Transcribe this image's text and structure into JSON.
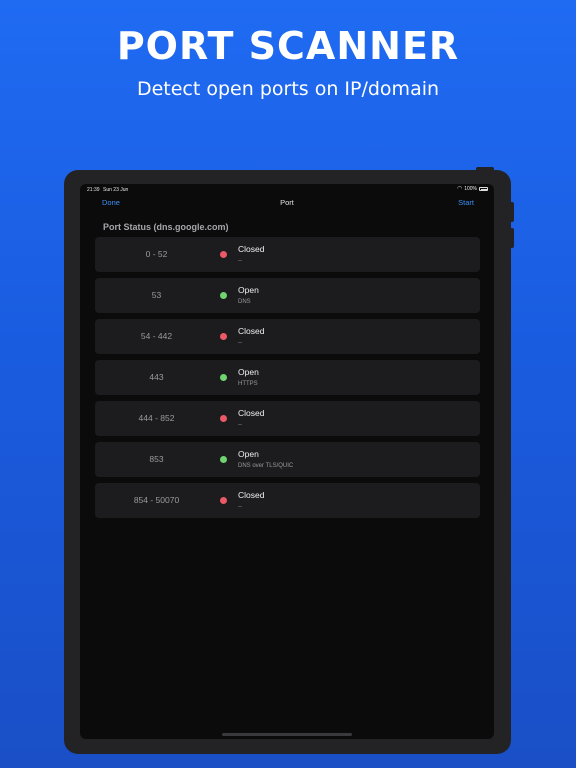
{
  "promo": {
    "title": "PORT SCANNER",
    "subtitle": "Detect open ports on IP/domain"
  },
  "status_bar": {
    "time": "21:39",
    "date": "Sun 23 Jun",
    "battery": "100%"
  },
  "nav": {
    "left_label": "Done",
    "title": "Port",
    "right_label": "Start"
  },
  "section": {
    "header": "Port Status (dns.google.com)"
  },
  "colors": {
    "closed": "#ea5965",
    "open": "#6fd36f",
    "accent": "#3a8ff5"
  },
  "ports": [
    {
      "range": "0 - 52",
      "status": "Closed",
      "detail": "--"
    },
    {
      "range": "53",
      "status": "Open",
      "detail": "DNS"
    },
    {
      "range": "54 - 442",
      "status": "Closed",
      "detail": "--"
    },
    {
      "range": "443",
      "status": "Open",
      "detail": "HTTPS"
    },
    {
      "range": "444 - 852",
      "status": "Closed",
      "detail": "--"
    },
    {
      "range": "853",
      "status": "Open",
      "detail": "DNS over TLS/QUIC"
    },
    {
      "range": "854 - 50070",
      "status": "Closed",
      "detail": "--"
    }
  ]
}
